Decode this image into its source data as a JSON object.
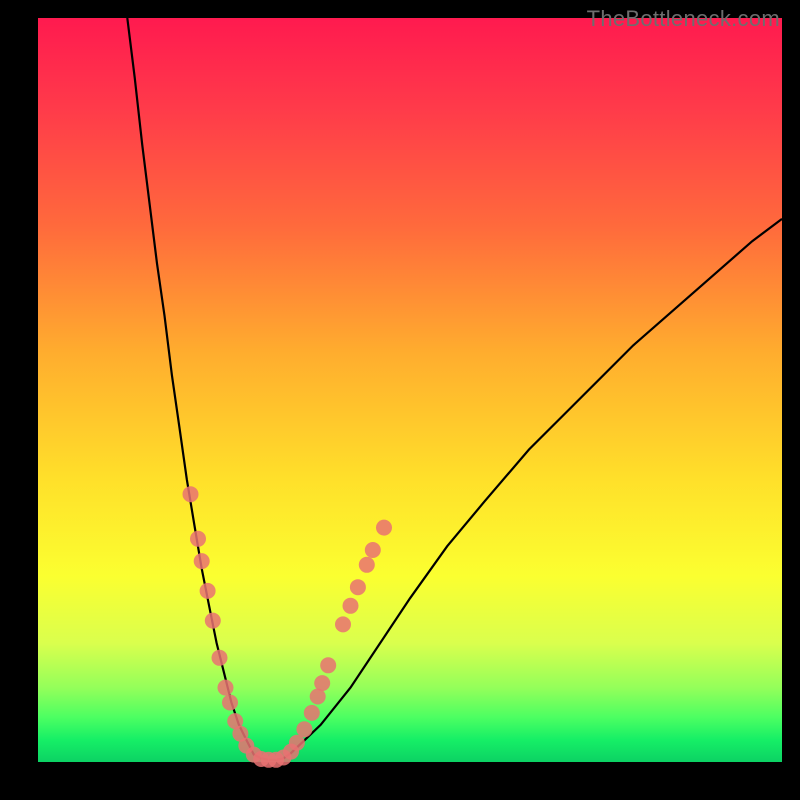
{
  "watermark": "TheBottleneck.com",
  "colors": {
    "background": "#000000",
    "curve": "#000000",
    "dot": "#e97272",
    "gradient_stops": [
      "#ff1a4f",
      "#ff3a4a",
      "#ff6a3c",
      "#ffad2e",
      "#ffe02a",
      "#fbff30",
      "#daff4d",
      "#94ff5a",
      "#4cff62",
      "#16ef66",
      "#0cd264"
    ]
  },
  "chart_data": {
    "type": "line",
    "title": "",
    "xlabel": "",
    "ylabel": "",
    "xlim": [
      0,
      100
    ],
    "ylim": [
      0,
      100
    ],
    "series": [
      {
        "name": "v-curve",
        "x": [
          12,
          13,
          14,
          15,
          16,
          17,
          18,
          19,
          20,
          21,
          22,
          23,
          24,
          25,
          26,
          27,
          28,
          29,
          30,
          31,
          32,
          33,
          34,
          38,
          42,
          46,
          50,
          55,
          60,
          66,
          72,
          80,
          88,
          96,
          100
        ],
        "y": [
          100,
          92,
          83,
          75,
          67,
          60,
          52,
          45,
          38,
          32,
          26,
          21,
          16,
          12,
          8,
          5,
          3,
          1,
          0.5,
          0.3,
          0.3,
          0.5,
          1.2,
          5,
          10,
          16,
          22,
          29,
          35,
          42,
          48,
          56,
          63,
          70,
          73
        ]
      }
    ],
    "dots": [
      {
        "x": 20.5,
        "y": 36
      },
      {
        "x": 21.5,
        "y": 30
      },
      {
        "x": 22.0,
        "y": 27
      },
      {
        "x": 22.8,
        "y": 23
      },
      {
        "x": 23.5,
        "y": 19
      },
      {
        "x": 24.4,
        "y": 14
      },
      {
        "x": 25.2,
        "y": 10
      },
      {
        "x": 25.8,
        "y": 8
      },
      {
        "x": 26.5,
        "y": 5.5
      },
      {
        "x": 27.2,
        "y": 3.8
      },
      {
        "x": 28.0,
        "y": 2.2
      },
      {
        "x": 29.0,
        "y": 1.0
      },
      {
        "x": 30.0,
        "y": 0.4
      },
      {
        "x": 31.0,
        "y": 0.3
      },
      {
        "x": 32.0,
        "y": 0.3
      },
      {
        "x": 33.0,
        "y": 0.6
      },
      {
        "x": 34.0,
        "y": 1.4
      },
      {
        "x": 34.8,
        "y": 2.6
      },
      {
        "x": 35.8,
        "y": 4.4
      },
      {
        "x": 36.8,
        "y": 6.6
      },
      {
        "x": 37.6,
        "y": 8.8
      },
      {
        "x": 38.2,
        "y": 10.6
      },
      {
        "x": 39.0,
        "y": 13.0
      },
      {
        "x": 41.0,
        "y": 18.5
      },
      {
        "x": 42.0,
        "y": 21.0
      },
      {
        "x": 43.0,
        "y": 23.5
      },
      {
        "x": 44.2,
        "y": 26.5
      },
      {
        "x": 45.0,
        "y": 28.5
      },
      {
        "x": 46.5,
        "y": 31.5
      }
    ]
  }
}
